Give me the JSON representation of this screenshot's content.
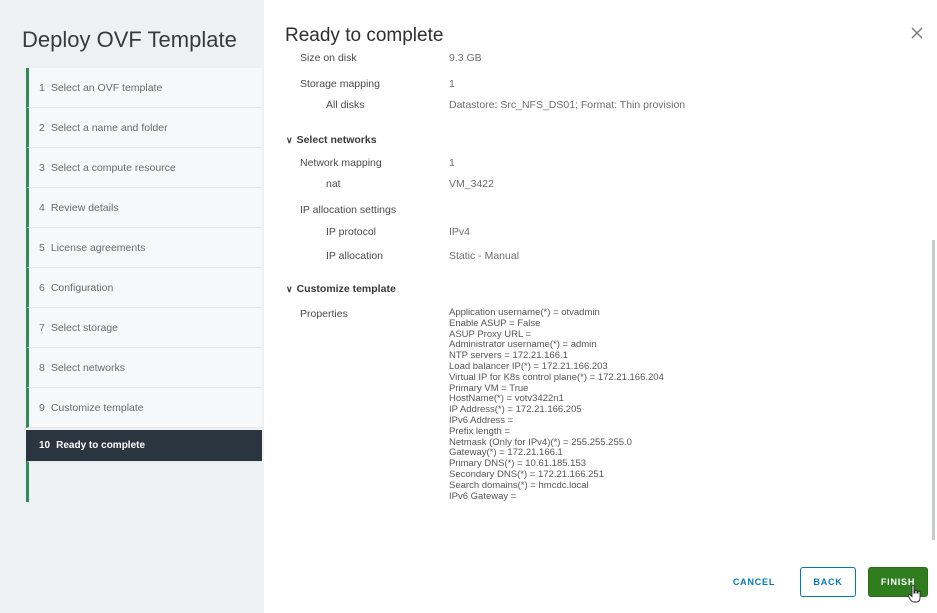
{
  "wizard": {
    "title": "Deploy OVF Template",
    "steps": [
      {
        "num": "1",
        "label": "Select an OVF template"
      },
      {
        "num": "2",
        "label": "Select a name and folder"
      },
      {
        "num": "3",
        "label": "Select a compute resource"
      },
      {
        "num": "4",
        "label": "Review details"
      },
      {
        "num": "5",
        "label": "License agreements"
      },
      {
        "num": "6",
        "label": "Configuration"
      },
      {
        "num": "7",
        "label": "Select storage"
      },
      {
        "num": "8",
        "label": "Select networks"
      },
      {
        "num": "9",
        "label": "Customize template"
      },
      {
        "num": "10",
        "label": "Ready to complete"
      }
    ]
  },
  "page": {
    "title": "Ready to complete",
    "close_icon": "close-icon"
  },
  "details": {
    "size_on_disk_label": "Size on disk",
    "size_on_disk_value": "9.3 GB",
    "storage_mapping_label": "Storage mapping",
    "storage_mapping_value": "1",
    "all_disks_label": "All disks",
    "all_disks_value": "Datastore: Src_NFS_DS01; Format: Thin provision"
  },
  "networks": {
    "section_label": "Select networks",
    "network_mapping_label": "Network mapping",
    "network_mapping_value": "1",
    "nat_label": "nat",
    "nat_value": "VM_3422",
    "ip_alloc_settings_label": "IP allocation settings",
    "ip_protocol_label": "IP protocol",
    "ip_protocol_value": "IPv4",
    "ip_allocation_label": "IP allocation",
    "ip_allocation_value": "Static - Manual"
  },
  "customize": {
    "section_label": "Customize template",
    "properties_label": "Properties",
    "properties": [
      "Application username(*) = otvadmin",
      "Enable ASUP = False",
      "ASUP Proxy URL =",
      "Administrator username(*) = admin",
      "NTP servers = 172.21.166.1",
      "Load balancer IP(*) = 172.21.166.203",
      "Virtual IP for K8s control plane(*) = 172.21.166.204",
      "Primary VM = True",
      "HostName(*) = votv3422n1",
      "IP Address(*) = 172.21.166.205",
      "IPv6 Address =",
      "Prefix length =",
      "Netmask (Only for IPv4)(*) = 255.255.255.0",
      "Gateway(*) = 172.21.166.1",
      "Primary DNS(*) = 10.61.185.153",
      "Secondary DNS(*) = 172.21.166.251",
      "Search domains(*) = hmcdc.local",
      "IPv6 Gateway ="
    ]
  },
  "footer": {
    "cancel_label": "CANCEL",
    "back_label": "BACK",
    "finish_label": "FINISH"
  },
  "colors": {
    "accent_green": "#2e8b57",
    "finish_green": "#2f7d1f",
    "active_step_bg": "#2a3540",
    "link_blue": "#0079b8"
  }
}
